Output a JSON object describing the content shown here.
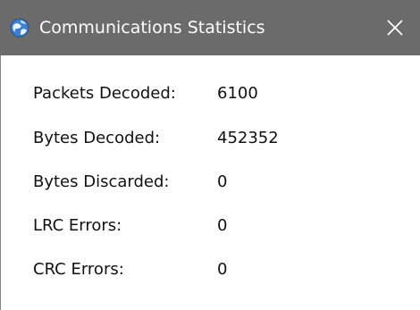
{
  "window": {
    "title": "Communications Statistics",
    "icon": "globe-app-icon",
    "close_icon": "close-icon"
  },
  "stats": [
    {
      "label": "Packets Decoded:",
      "value": "6100"
    },
    {
      "label": "Bytes Decoded:",
      "value": "452352"
    },
    {
      "label": "Bytes Discarded:",
      "value": "0"
    },
    {
      "label": "LRC Errors:",
      "value": "0"
    },
    {
      "label": "CRC Errors:",
      "value": "0"
    }
  ],
  "colors": {
    "titlebar": "#6b6b6b",
    "title_text": "#ffffff",
    "background": "#ffffff",
    "text": "#111111"
  }
}
